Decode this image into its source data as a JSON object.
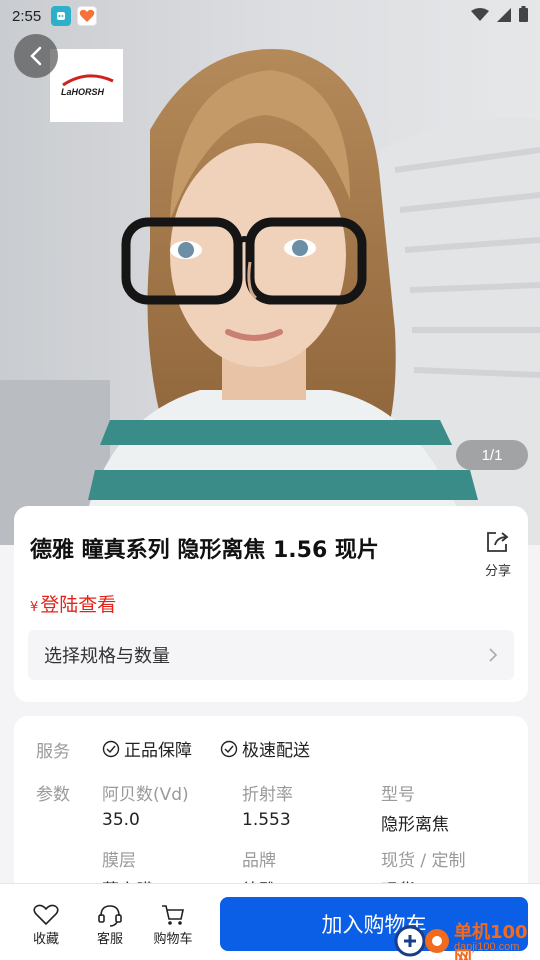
{
  "status_bar": {
    "time": "2:55"
  },
  "hero": {
    "logo_text": "LaHORSH",
    "image_counter": "1/1"
  },
  "product": {
    "title": "德雅 瞳真系列 隐形离焦 1.56 现片",
    "share_label": "分享",
    "price_symbol": "¥",
    "price_text": "登陆查看",
    "spec_selector_label": "选择规格与数量"
  },
  "details": {
    "service_label": "服务",
    "services": [
      "正品保障",
      "极速配送"
    ],
    "params_label": "参数",
    "params": [
      {
        "name": "阿贝数(Vd)",
        "value": "35.0"
      },
      {
        "name": "折射率",
        "value": "1.553"
      },
      {
        "name": "型号",
        "value": "隐形离焦"
      },
      {
        "name": "膜层",
        "value": "莲宝膜"
      },
      {
        "name": "品牌",
        "value": "德雅"
      },
      {
        "name": "现货 / 定制",
        "value": "现货"
      }
    ]
  },
  "bottom_bar": {
    "favorite_label": "收藏",
    "service_label": "客服",
    "cart_label": "购物车",
    "add_to_cart_label": "加入购物车"
  },
  "watermark": {
    "text": "单机100网",
    "sub": "danji100.com"
  },
  "colors": {
    "accent": "#0b5ee6",
    "price": "#e2231a",
    "watermark": "#f26b1d"
  }
}
